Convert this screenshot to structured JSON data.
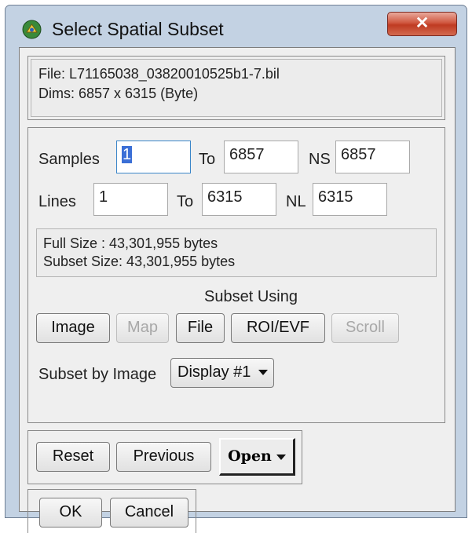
{
  "window": {
    "title": "Select Spatial Subset",
    "close_icon": "✕"
  },
  "file_info": {
    "file": "File: L71165038_03820010525b1-7.bil",
    "dims": "Dims: 6857 x 6315 (Byte)"
  },
  "samples": {
    "label": "Samples",
    "start": "1",
    "to_label": "To",
    "to_value": "6857",
    "n_label": "NS",
    "n_value": "6857"
  },
  "lines": {
    "label": "Lines",
    "start": "1",
    "to_label": "To",
    "to_value": "6315",
    "n_label": "NL",
    "n_value": "6315"
  },
  "size_info": {
    "full": "Full Size  : 43,301,955 bytes",
    "subset": "Subset Size: 43,301,955 bytes"
  },
  "subset_using": {
    "heading": "Subset Using",
    "buttons": {
      "image": "Image",
      "map": "Map",
      "file": "File",
      "roi": "ROI/EVF",
      "scroll": "Scroll"
    }
  },
  "subset_by": {
    "label": "Subset by Image",
    "value": "Display #1"
  },
  "actions": {
    "reset": "Reset",
    "previous": "Previous",
    "open": "Open"
  },
  "dialog": {
    "ok": "OK",
    "cancel": "Cancel"
  }
}
